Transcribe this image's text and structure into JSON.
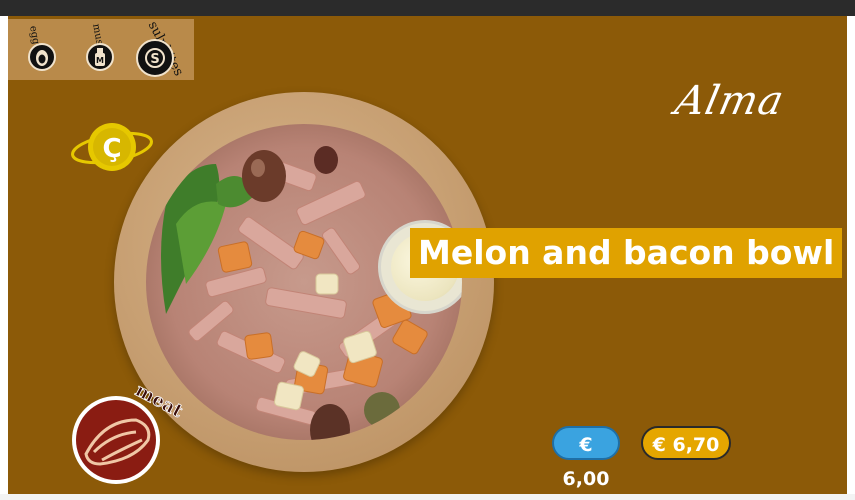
{
  "brand": {
    "name": "Alma"
  },
  "allergens": [
    {
      "label": "egg",
      "icon": "egg-icon"
    },
    {
      "label": "mustard",
      "icon": "mustard-icon",
      "glyph": "M"
    },
    {
      "label": "sulphites",
      "icon": "sulphites-icon",
      "glyph": "S"
    }
  ],
  "product": {
    "title": "Melon and bacon bowl"
  },
  "category": {
    "label": "meat",
    "icon": "meat-icon"
  },
  "badge": {
    "letter": "Ç",
    "icon": "c-badge-icon"
  },
  "prices": [
    {
      "value": "€ 6,00",
      "color": "#3aa3e0"
    },
    {
      "value": "€ 6,70",
      "color": "#e5a600"
    }
  ],
  "colors": {
    "background": "#8c5a08",
    "title_bg": "#e0a200",
    "allergen_panel": "#b98a4a",
    "meat_badge": "#8a1c12"
  }
}
